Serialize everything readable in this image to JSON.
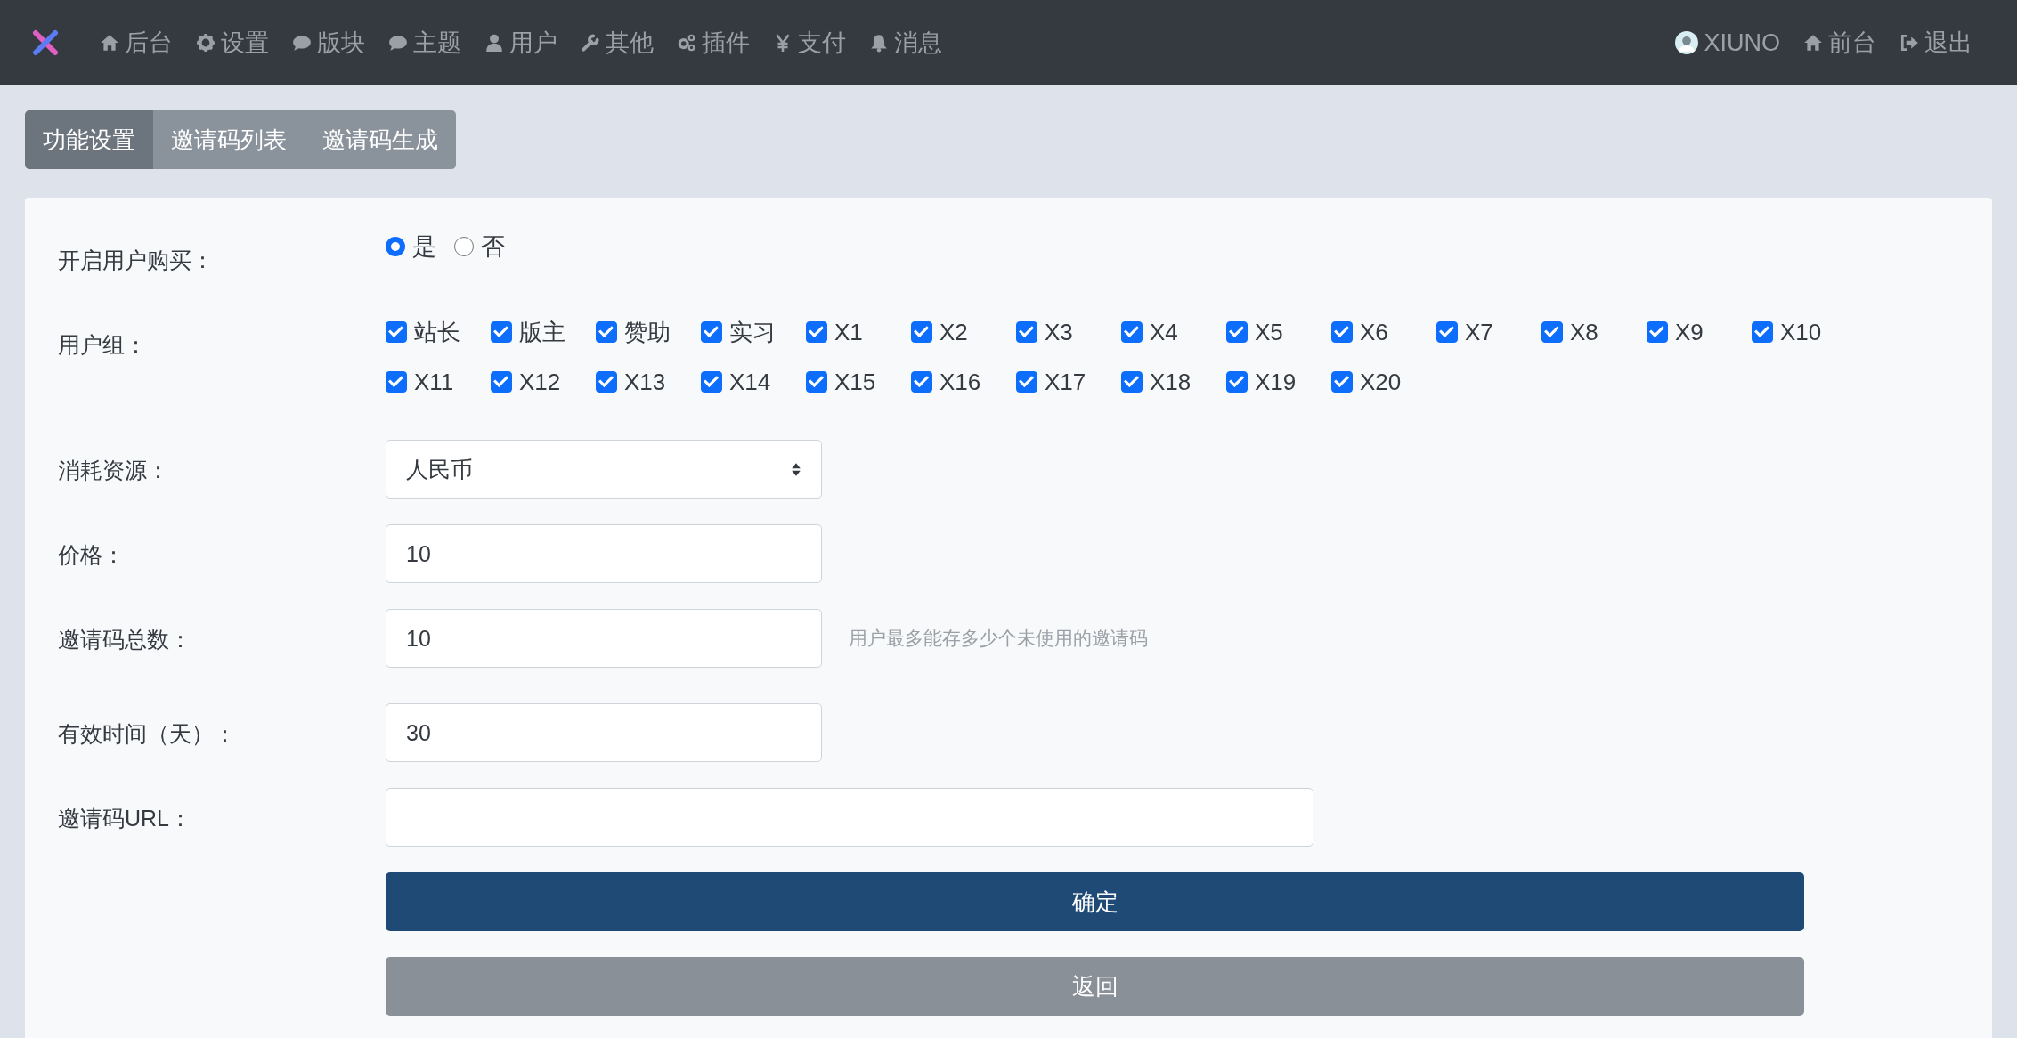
{
  "nav": {
    "items": [
      {
        "label": "后台"
      },
      {
        "label": "设置"
      },
      {
        "label": "版块"
      },
      {
        "label": "主题"
      },
      {
        "label": "用户"
      },
      {
        "label": "其他"
      },
      {
        "label": "插件"
      },
      {
        "label": "支付"
      },
      {
        "label": "消息"
      }
    ],
    "right": [
      {
        "label": "XIUNO"
      },
      {
        "label": "前台"
      },
      {
        "label": "退出"
      }
    ]
  },
  "tabs": [
    {
      "label": "功能设置",
      "selected": true
    },
    {
      "label": "邀请码列表",
      "selected": false
    },
    {
      "label": "邀请码生成",
      "selected": false
    }
  ],
  "form": {
    "rows": [
      {
        "kind": "radio",
        "label": "开启用户购买：",
        "options": [
          {
            "label": "是",
            "selected": true
          },
          {
            "label": "否",
            "selected": false
          }
        ]
      },
      {
        "kind": "checks",
        "label": "用户组：",
        "options": [
          {
            "label": "站长",
            "checked": true
          },
          {
            "label": "版主",
            "checked": true
          },
          {
            "label": "赞助",
            "checked": true
          },
          {
            "label": "实习",
            "checked": true
          },
          {
            "label": "X1",
            "checked": true
          },
          {
            "label": "X2",
            "checked": true
          },
          {
            "label": "X3",
            "checked": true
          },
          {
            "label": "X4",
            "checked": true
          },
          {
            "label": "X5",
            "checked": true
          },
          {
            "label": "X6",
            "checked": true
          },
          {
            "label": "X7",
            "checked": true
          },
          {
            "label": "X8",
            "checked": true
          },
          {
            "label": "X9",
            "checked": true
          },
          {
            "label": "X10",
            "checked": true
          },
          {
            "label": "X11",
            "checked": true
          },
          {
            "label": "X12",
            "checked": true
          },
          {
            "label": "X13",
            "checked": true
          },
          {
            "label": "X14",
            "checked": true
          },
          {
            "label": "X15",
            "checked": true
          },
          {
            "label": "X16",
            "checked": true
          },
          {
            "label": "X17",
            "checked": true
          },
          {
            "label": "X18",
            "checked": true
          },
          {
            "label": "X19",
            "checked": true
          },
          {
            "label": "X20",
            "checked": true
          }
        ]
      },
      {
        "kind": "select",
        "label": "消耗资源：",
        "value": "人民币"
      },
      {
        "kind": "input",
        "label": "价格：",
        "value": "10"
      },
      {
        "kind": "input",
        "label": "邀请码总数：",
        "value": "10",
        "help": "用户最多能存多少个未使用的邀请码"
      },
      {
        "kind": "input",
        "label": "有效时间（天）：",
        "value": "30"
      },
      {
        "kind": "wide",
        "label": "邀请码URL："
      }
    ],
    "buttons": [
      {
        "kind": "primary",
        "label": "确定"
      },
      {
        "kind": "secondary",
        "label": "返回"
      }
    ]
  }
}
